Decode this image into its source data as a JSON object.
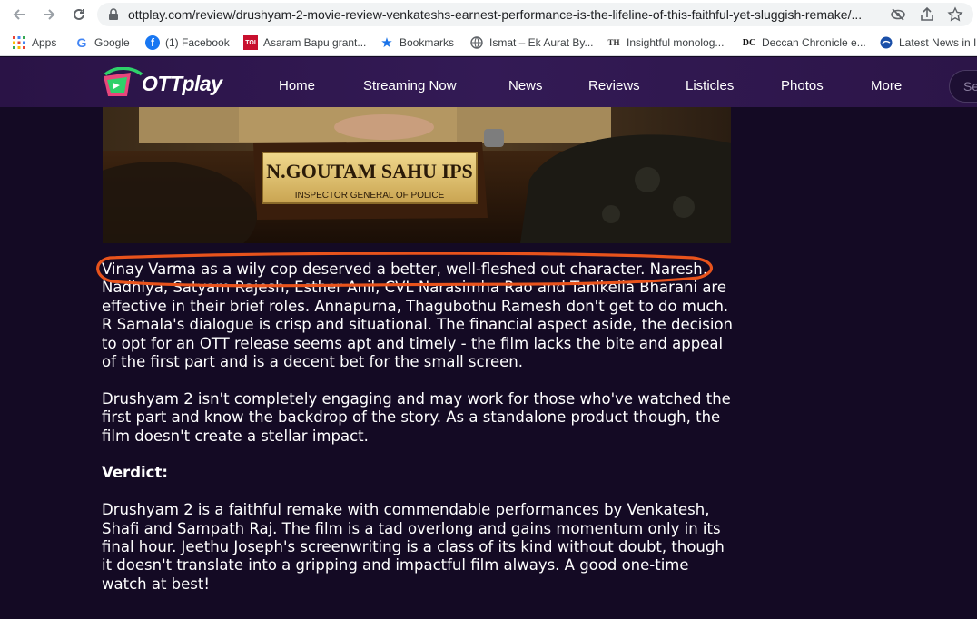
{
  "browser": {
    "url": "ottplay.com/review/drushyam-2-movie-review-venkateshs-earnest-performance-is-the-lifeline-of-this-faithful-yet-sluggish-remake/..."
  },
  "bookmarks": [
    {
      "label": "Apps",
      "icon": "apps-grid-icon"
    },
    {
      "label": "Google",
      "icon": "google-icon"
    },
    {
      "label": "(1) Facebook",
      "icon": "facebook-icon"
    },
    {
      "label": "Asaram Bapu grant...",
      "icon": "toi-icon",
      "icon_text": "TOI"
    },
    {
      "label": "Bookmarks",
      "icon": "star-icon"
    },
    {
      "label": "Ismat – Ek Aurat By...",
      "icon": "globe-icon"
    },
    {
      "label": "Insightful monolog...",
      "icon": "th-icon",
      "icon_text": "TH"
    },
    {
      "label": "Deccan Chronicle e...",
      "icon": "dc-icon",
      "icon_text": "DC"
    },
    {
      "label": "Latest News in I",
      "icon": "news-icon"
    }
  ],
  "site": {
    "logo_text": "OTTplay",
    "nav": [
      "Home",
      "Streaming Now",
      "News",
      "Reviews",
      "Listicles",
      "Photos",
      "More"
    ],
    "search_placeholder": "Se",
    "hero_nameplate": {
      "name": "N.GOUTAM SAHU IPS",
      "title": "INSPECTOR GENERAL OF POLICE"
    }
  },
  "article": {
    "paragraphs": [
      "Vinay Varma as a wily cop deserved a better, well-fleshed out character. Naresh, Nadhiya, Satyam Rajesh, Esther Anil, CVL Narasimha Rao and Tanikella Bharani are effective in their brief roles. Annapurna, Thagubothu Ramesh don't get to do much. R Samala's dialogue is crisp and situational. The financial aspect aside, the decision to opt for an OTT release seems apt and timely - the film lacks the bite and appeal of the first part and is a decent bet for the small screen.",
      "Drushyam 2 isn't completely engaging and may work for those who've watched the first part and know the backdrop of the story. As a standalone product though, the film doesn't create a stellar impact.",
      "Verdict:",
      "Drushyam 2 is a faithful remake with commendable performances by Venkatesh, Shafi and Sampath Raj. The film is a tad overlong and gains momentum only in its final hour. Jeethu Joseph's screenwriting is a class of its kind without doubt, though it doesn't translate into a gripping and impactful film always. A good one-time watch at best!"
    ]
  },
  "colors": {
    "page_bg": "#140a24",
    "header_bg": "#331a55",
    "highlight_stroke": "#e8531c",
    "logo_green": "#2fd06a",
    "logo_pink": "#e8467c"
  }
}
